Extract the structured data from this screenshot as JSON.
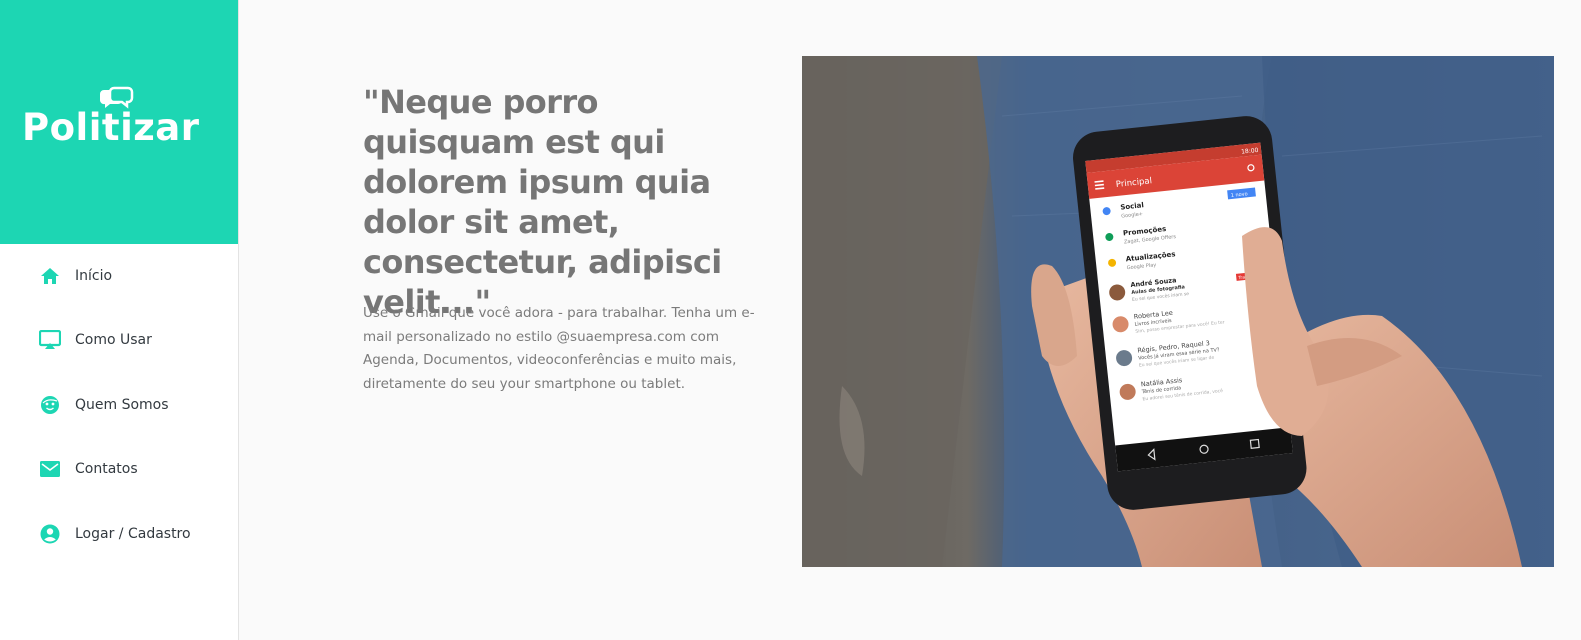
{
  "brand": {
    "name": "Politizar",
    "color": "#1dd6b3"
  },
  "nav": {
    "items": [
      {
        "label": "Início",
        "icon": "home-icon"
      },
      {
        "label": "Como Usar",
        "icon": "airplay-icon"
      },
      {
        "label": "Quem Somos",
        "icon": "face-icon"
      },
      {
        "label": "Contatos",
        "icon": "mail-icon"
      },
      {
        "label": "Logar / Cadastro",
        "icon": "account-circle-icon"
      }
    ],
    "icon_color": "#1dd6b3"
  },
  "hero": {
    "quote": "\"Neque porro quisquam est qui dolorem ipsum quia dolor sit amet, consectetur, adipisci velit...\"",
    "description": "Use o Gmail que você adora - para trabalhar. Tenha um e-mail personalizado no estilo @suaempresa.com com Agenda, Documentos, videoconferências e muito mais, diretamente do seu your smartphone ou tablet."
  },
  "phone_screen": {
    "time": "18:00",
    "header": "Principal",
    "new_badge": "1 novo",
    "rows": [
      {
        "title": "Social",
        "sub": "Google+"
      },
      {
        "title": "Promoções",
        "sub": "Zagat, Google Offers"
      },
      {
        "title": "Atualizações",
        "sub": "Google Play"
      },
      {
        "title": "André Souza",
        "sub": "Aulas de fotografia",
        "preview": "Eu sei que vocês iriam se",
        "tag": "Trabalho"
      },
      {
        "title": "Roberta Lee",
        "sub": "Livros incríveis",
        "preview": "Sim, posso emprestar para você! Eu ter"
      },
      {
        "title": "Régis, Pedro, Raquel 3",
        "sub": "Vocês já viram essa série na TV?",
        "preview": "Eu sei que vocês iriam se ligar de"
      },
      {
        "title": "Natália Assis",
        "sub": "Tênis de corrida",
        "preview": "Eu adorei seu tênis de corrida, você"
      }
    ]
  }
}
